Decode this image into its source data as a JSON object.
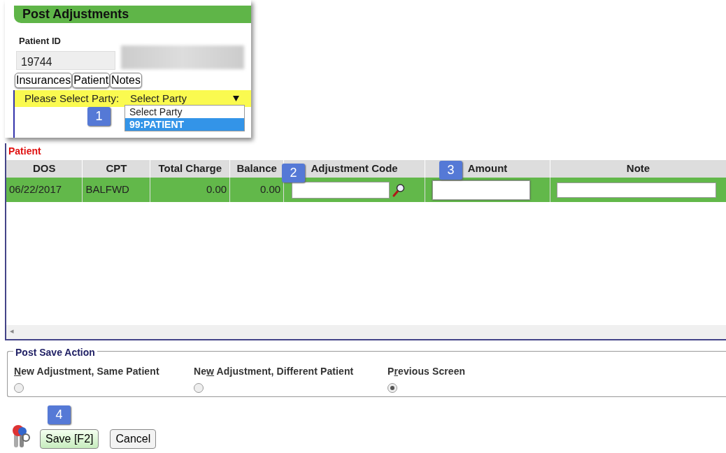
{
  "popup": {
    "title": "Post Adjustments",
    "patient_id_label": "Patient ID",
    "patient_id": "19744",
    "tabs": [
      "Insurances",
      "Patient",
      "Notes"
    ],
    "party_label": "Please Select Party:",
    "party_select": "Select Party",
    "options": [
      {
        "label": "Select Party",
        "selected": false
      },
      {
        "label": "99:PATIENT",
        "selected": true
      }
    ]
  },
  "section_title": "Patient",
  "table": {
    "columns": [
      "DOS",
      "CPT",
      "Total Charge",
      "Balance",
      "Adjustment Code",
      "Amount",
      "Note"
    ],
    "rows": [
      {
        "dos": "06/22/2017",
        "cpt": "BALFWD",
        "total_charge": "0.00",
        "balance": "0.00"
      }
    ]
  },
  "scroll_arrow": "◂",
  "post_save": {
    "legend": "Post Save Action",
    "options": [
      {
        "key": "N",
        "after": "ew Adjustment, Same Patient",
        "selected": false
      },
      {
        "before": "Ne",
        "key": "w",
        "after": " Adjustment, Different Patient",
        "selected": false
      },
      {
        "before": "P",
        "key": "r",
        "after": "evious Screen",
        "selected": true
      }
    ]
  },
  "buttons": [
    "Save [F2]",
    "Cancel"
  ],
  "callouts": [
    "1",
    "2",
    "3",
    "4"
  ]
}
